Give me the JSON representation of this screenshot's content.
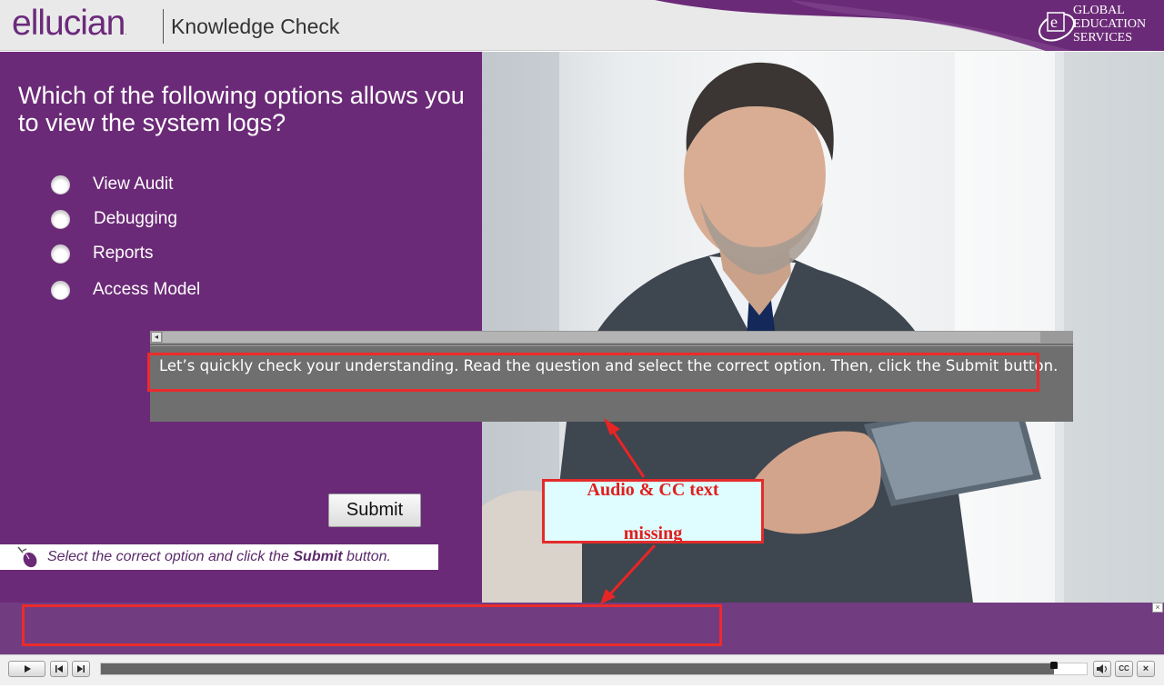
{
  "header": {
    "logo_text": "ellucian",
    "logo_mark": ".",
    "title": "Knowledge Check",
    "ges_lines": [
      "GL",
      "BAL",
      "EDUCATION",
      "SERVICES"
    ],
    "ges_line1": "GLOBAL",
    "ges_line2": "EDUCATION",
    "ges_line3": "SERVICES"
  },
  "question": {
    "text": "Which of the following options allows you to view the system logs?",
    "options": [
      {
        "label": "View Audit",
        "selected": false
      },
      {
        "label": "Debugging",
        "selected": false
      },
      {
        "label": "Reports",
        "selected": false
      },
      {
        "label": "Access Model",
        "selected": false
      }
    ],
    "submit_label": "Submit",
    "instruction_pre": "Select the correct option and click the ",
    "instruction_bold": "Submit",
    "instruction_post": " button."
  },
  "captions": {
    "text": "Let’s quickly check your understanding. Read the question and select the correct option. Then, click the Submit button."
  },
  "annotation": {
    "line1": "Audio & CC text",
    "line2": "missing",
    "color": "#e01e1e"
  },
  "player": {
    "progress": 0.967,
    "cc_label": "CC",
    "close_label": "×"
  },
  "colors": {
    "purple": "#6b2a77",
    "strip": "#723c81",
    "annotation_red": "#ec2b2b"
  }
}
